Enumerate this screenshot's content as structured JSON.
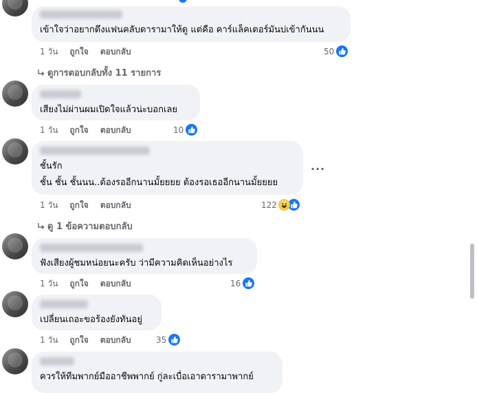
{
  "comments": [
    {
      "text_lines": [
        "เข้าใจว่าอยากดึงแฟนคลับดารามาให้ดู แต่คือ คาร์แล็คเตอร์มันบ่เข้ากันนน"
      ],
      "time": "1 วัน",
      "like": "ถูกใจ",
      "reply": "ตอบกลับ",
      "reactions": "50",
      "reaction_icons": [
        "like-icon"
      ]
    },
    {
      "text_lines": [
        "เสียงไม่ผ่านผมเปิดใจแล้วน่ะบอกเลย"
      ],
      "time": "1 วัน",
      "like": "ถูกใจ",
      "reply": "ตอบกลับ",
      "reactions": "10",
      "reaction_icons": [
        "like-icon"
      ]
    },
    {
      "text_lines": [
        "ชั้นรัก",
        "ชั้น ชั้น ชั้นนน..ต้องรออีกนานมั้ยยยย ต้องรอเธออีกนานมั้ยยยย"
      ],
      "time": "1 วัน",
      "like": "ถูกใจ",
      "reply": "ตอบกลับ",
      "reactions": "122",
      "reaction_icons": [
        "haha-icon",
        "like-icon"
      ],
      "more": "···"
    },
    {
      "text_lines": [
        "ฟังเสียงผู้ชมหน่อยนะครับ ว่ามีความคิดเห็นอย่างไร"
      ],
      "time": "1 วัน",
      "like": "ถูกใจ",
      "reply": "ตอบกลับ",
      "reactions": "16",
      "reaction_icons": [
        "like-icon"
      ]
    },
    {
      "text_lines": [
        "เปลี่ยนเถอะขอร้องยังทันอยู่"
      ],
      "time": "1 วัน",
      "like": "ถูกใจ",
      "reply": "ตอบกลับ",
      "reactions": "35",
      "reaction_icons": [
        "like-icon"
      ]
    },
    {
      "text_lines": [
        "ควรให้ทีมพากย์มืออาชีพพากย์ กู่ละเบื่อเอาดารามาพากย์"
      ]
    }
  ],
  "view_all_replies": "ดูการตอบกลับทั้ง 11 รายการ",
  "view_one_reply": "ดู 1 ข้อความตอบกลับ",
  "colors": {
    "bubble": "#f0f2f5",
    "meta": "#65676b",
    "like_blue": "#1877f2"
  }
}
